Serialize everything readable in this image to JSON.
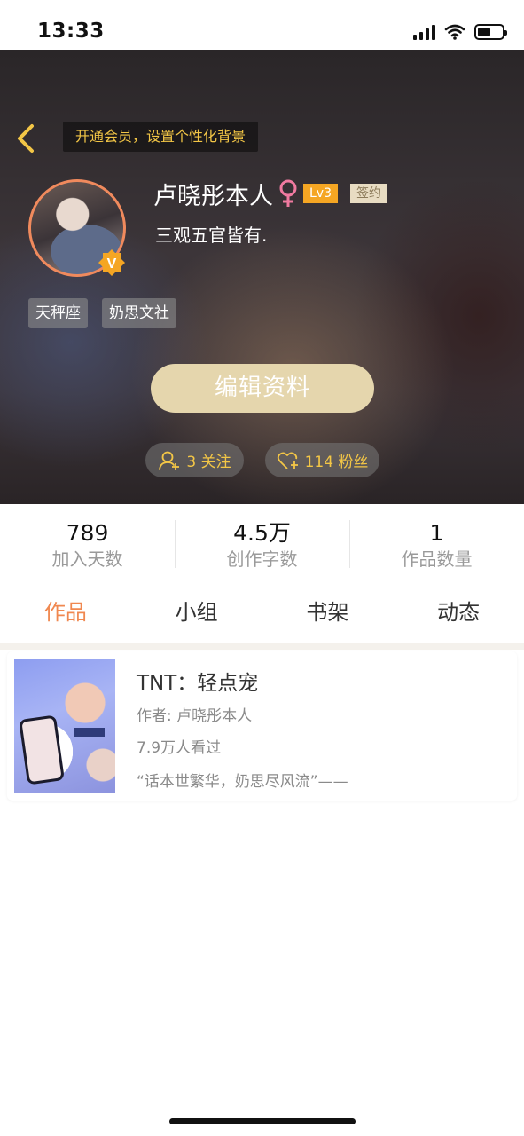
{
  "status_bar": {
    "time": "13:33",
    "signal_icon": "signal-bars-icon",
    "wifi_icon": "wifi-icon",
    "battery_icon": "battery-icon"
  },
  "header": {
    "back_icon": "chevron-left-icon",
    "vip_tip": "开通会员，设置个性化背景",
    "accent_color": "#f3c646"
  },
  "profile": {
    "name": "卢晓彤本人",
    "gender_icon": "female-icon",
    "level": "Lv3",
    "signed_badge": "签约",
    "bio": "三观五官皆有.",
    "verified_badge": "V",
    "tags": [
      "天秤座",
      "奶思文社"
    ]
  },
  "actions": {
    "edit_profile": "编辑资料",
    "following": "3 关注",
    "followers": "114 粉丝"
  },
  "stats": [
    {
      "value": "789",
      "label": "加入天数"
    },
    {
      "value": "4.5万",
      "label": "创作字数"
    },
    {
      "value": "1",
      "label": "作品数量"
    }
  ],
  "tabs": [
    {
      "label": "作品",
      "active": true
    },
    {
      "label": "小组",
      "active": false
    },
    {
      "label": "书架",
      "active": false
    },
    {
      "label": "动态",
      "active": false
    }
  ],
  "works": [
    {
      "title": "TNT：轻点宠",
      "author": "作者: 卢晓彤本人",
      "views": "7.9万人看过",
      "quote": "“话本世繁华，奶思尽风流”——"
    }
  ],
  "colors": {
    "tab_active": "#f08850",
    "edit_button": "#e5d6ad",
    "level_badge": "#f5a623"
  }
}
